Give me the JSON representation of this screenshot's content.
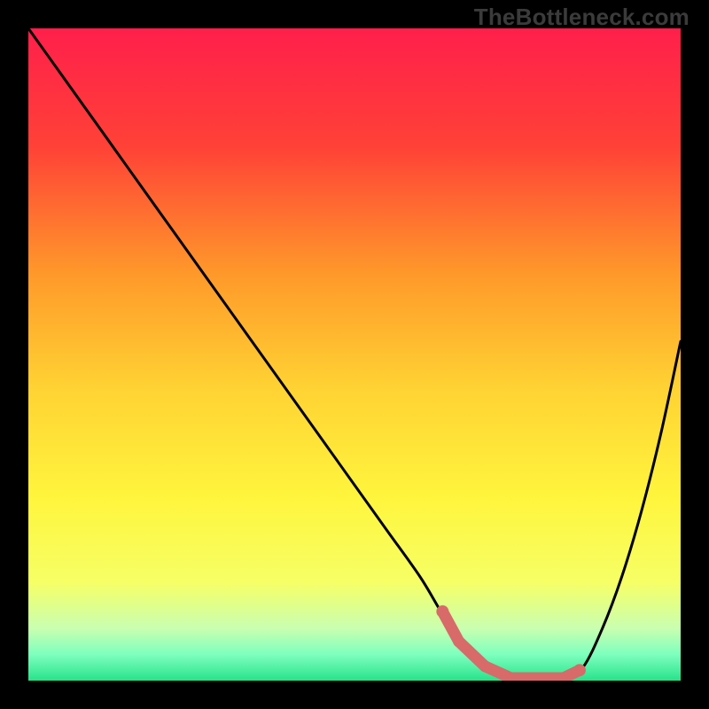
{
  "watermark": "TheBottleneck.com",
  "chart_data": {
    "type": "line",
    "title": "",
    "xlabel": "",
    "ylabel": "",
    "xlim": [
      0,
      100
    ],
    "ylim": [
      0,
      100
    ],
    "grid": false,
    "x": [
      0,
      5,
      10,
      15,
      20,
      25,
      30,
      35,
      40,
      45,
      50,
      55,
      60,
      63,
      66,
      70,
      74,
      78,
      82,
      85,
      88,
      91,
      94,
      97,
      100
    ],
    "values": [
      100,
      93,
      86,
      79,
      72,
      65,
      58,
      51,
      44,
      37,
      30,
      23,
      16,
      11,
      6,
      2,
      0,
      0,
      0,
      2,
      8,
      16,
      26,
      38,
      52
    ],
    "marker_x": [
      63.5,
      66,
      70,
      74,
      78,
      82,
      84.5
    ],
    "marker_y": [
      10.6,
      6.0,
      2.2,
      0.4,
      0.4,
      0.4,
      1.6
    ],
    "marker_color": "#d86a6a",
    "curve_color": "#000000",
    "background": "rainbow-vertical",
    "gradient_stops": [
      {
        "offset": 0,
        "color": "#ff1f4b"
      },
      {
        "offset": 18,
        "color": "#ff4137"
      },
      {
        "offset": 38,
        "color": "#ff9a2a"
      },
      {
        "offset": 55,
        "color": "#ffd233"
      },
      {
        "offset": 72,
        "color": "#fff53d"
      },
      {
        "offset": 85,
        "color": "#f6ff66"
      },
      {
        "offset": 92,
        "color": "#c9ffb0"
      },
      {
        "offset": 96,
        "color": "#7dffbe"
      },
      {
        "offset": 100,
        "color": "#27e38a"
      }
    ]
  }
}
